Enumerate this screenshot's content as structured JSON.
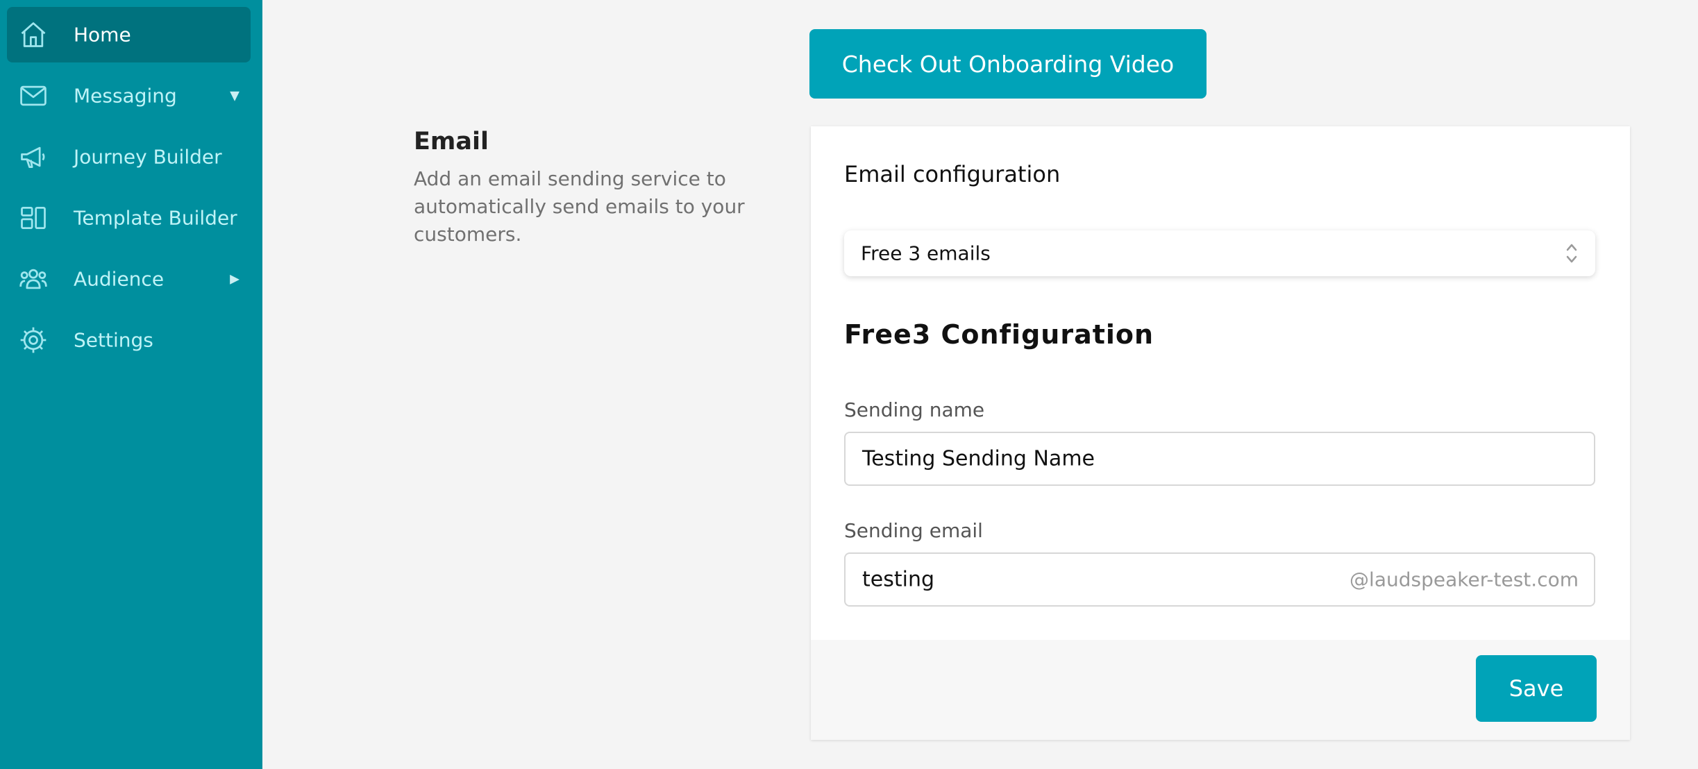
{
  "sidebar": {
    "items": [
      {
        "label": "Home",
        "icon": "home-icon"
      },
      {
        "label": "Messaging",
        "icon": "mail-icon",
        "caret": "▼"
      },
      {
        "label": "Journey Builder",
        "icon": "megaphone-icon"
      },
      {
        "label": "Template Builder",
        "icon": "layout-icon"
      },
      {
        "label": "Audience",
        "icon": "users-icon",
        "caret": "▶"
      },
      {
        "label": "Settings",
        "icon": "gear-icon"
      }
    ],
    "active_index": 0
  },
  "main": {
    "onboarding_button": "Check Out Onboarding Video",
    "section": {
      "title": "Email",
      "description": "Add an email sending service to automatically send emails to your customers."
    },
    "card": {
      "config_title": "Email configuration",
      "provider_select": {
        "value": "Free 3 emails"
      },
      "provider_title": "Free3 Configuration",
      "sending_name": {
        "label": "Sending name",
        "value": "Testing Sending Name"
      },
      "sending_email": {
        "label": "Sending email",
        "value": "testing",
        "suffix": "@laudspeaker-test.com"
      },
      "save_label": "Save"
    }
  },
  "colors": {
    "sidebar_bg": "#008f9e",
    "sidebar_active": "#00727e",
    "accent": "#00a3b8"
  }
}
